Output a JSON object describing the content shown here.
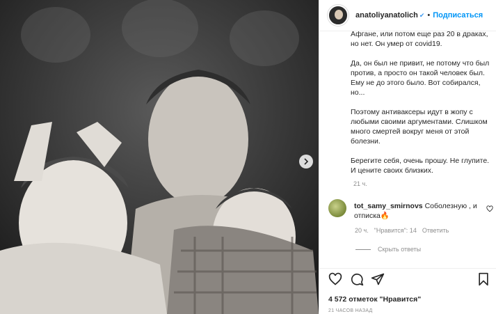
{
  "post": {
    "username": "anatoliyanatolich",
    "verified_icon": "verified-badge-icon",
    "separator": "•",
    "follow_label": "Подписаться",
    "caption_text": "Афгане, или потом еще раз 20 в драках, но нет. Он умер от covid19.\n\nДа, он был не привит, не потому что был против, а просто он такой человек был. Ему не до этого было. Вот собирался, но...\n\nПоэтому антиваксеры идут в жопу с любыми своими аргументами. Слишком много смертей вокруг меня от этой болезни.\n\nБерегите себя, очень прошу. Не глупите. И цените своих близких.",
    "caption_time": "21 ч.",
    "likes": "4 572 отметок \"Нравится\"",
    "post_time": "21 ЧАСОВ НАЗАД"
  },
  "comment": {
    "username": "tot_samy_smirnovs",
    "text": "Соболезную , и отписка🔥",
    "time": "20 ч.",
    "likes_label": "\"Нравится\": 14",
    "reply_label": "Ответить",
    "hide_replies_label": "Скрыть ответы"
  },
  "colors": {
    "accent": "#0095f6",
    "secondary_text": "#8e8e8e",
    "border": "#efefef"
  }
}
